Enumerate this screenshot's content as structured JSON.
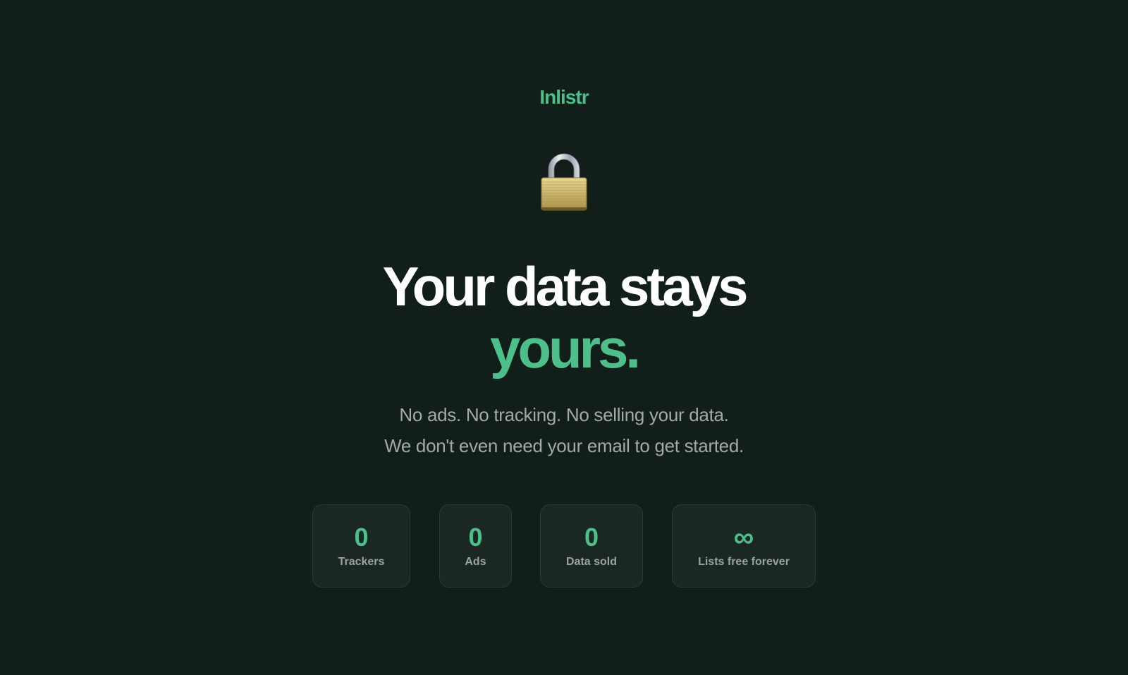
{
  "brand": {
    "name": "Inlistr",
    "color": "#4cbf8a"
  },
  "hero": {
    "icon": "lock-icon",
    "headline_line1": "Your data stays",
    "headline_line2": "yours.",
    "subtitle_line1": "No ads. No tracking. No selling your data.",
    "subtitle_line2": "We don't even need your email to get started."
  },
  "stats": [
    {
      "value": "0",
      "label": "Trackers"
    },
    {
      "value": "0",
      "label": "Ads"
    },
    {
      "value": "0",
      "label": "Data sold"
    },
    {
      "value": "∞",
      "label": "Lists free forever"
    }
  ],
  "colors": {
    "background": "#121e19",
    "accent": "#4cbf8a",
    "card_background": "#1a2722",
    "card_border": "#2c3a34"
  }
}
